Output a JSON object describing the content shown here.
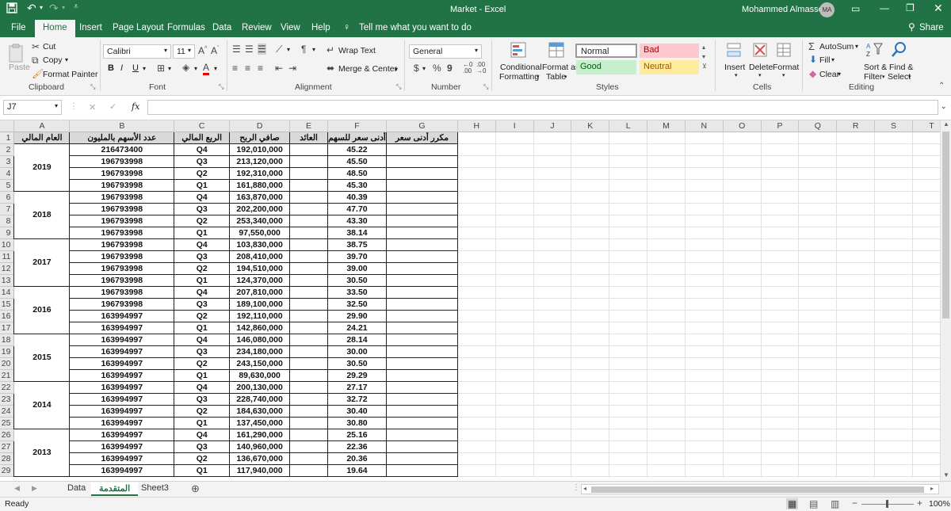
{
  "title": {
    "text": "Market  -  Excel",
    "user": "Mohammed Almasseri",
    "avatar": "MA"
  },
  "tabs": [
    "File",
    "Home",
    "Insert",
    "Page Layout",
    "Formulas",
    "Data",
    "Review",
    "View",
    "Help"
  ],
  "tell_me": "Tell me what you want to do",
  "share": "Share",
  "clipboard": {
    "paste": "Paste",
    "cut": "Cut",
    "copy": "Copy",
    "format_painter": "Format Painter",
    "group": "Clipboard"
  },
  "font": {
    "name": "Calibri",
    "size": "11",
    "bold": "B",
    "italic": "I",
    "underline": "U",
    "group": "Font"
  },
  "alignment": {
    "wrap": "Wrap Text",
    "merge": "Merge & Center",
    "group": "Alignment"
  },
  "number": {
    "format": "General",
    "currency": "$",
    "percent": "%",
    "comma": "9",
    "group": "Number"
  },
  "styles": {
    "cond1": "Conditional",
    "cond2": "Formatting",
    "fmt1": "Format as",
    "fmt2": "Table",
    "normal": "Normal",
    "bad": "Bad",
    "good": "Good",
    "neutral": "Neutral",
    "group": "Styles"
  },
  "cells": {
    "insert": "Insert",
    "delete": "Delete",
    "format": "Format",
    "group": "Cells"
  },
  "editing": {
    "autosum": "AutoSum",
    "fill": "Fill",
    "clear": "Clear",
    "sort1": "Sort &",
    "sort2": "Filter",
    "find1": "Find &",
    "find2": "Select",
    "group": "Editing"
  },
  "formula_bar": {
    "name_box": "J7",
    "value": "",
    "fx": "fx"
  },
  "columns": [
    "A",
    "B",
    "C",
    "D",
    "E",
    "F",
    "G",
    "H",
    "I",
    "J",
    "K",
    "L",
    "M",
    "N",
    "O",
    "P",
    "Q",
    "R",
    "S",
    "T"
  ],
  "header_row": [
    "العام المالي",
    "عدد الأسهم بالمليون",
    "الربع المالي",
    "صافي الربح",
    "العائد",
    "أدنى سعر للسهم",
    "مكرر أدنى سعر"
  ],
  "year_groups": [
    {
      "year": "2019",
      "rows": [
        [
          "216473400",
          "Q4",
          "192,010,000",
          "45.22"
        ],
        [
          "196793998",
          "Q3",
          "213,120,000",
          "45.50"
        ],
        [
          "196793998",
          "Q2",
          "192,310,000",
          "48.50"
        ],
        [
          "196793998",
          "Q1",
          "161,880,000",
          "45.30"
        ]
      ]
    },
    {
      "year": "2018",
      "rows": [
        [
          "196793998",
          "Q4",
          "163,870,000",
          "40.39"
        ],
        [
          "196793998",
          "Q3",
          "202,200,000",
          "47.70"
        ],
        [
          "196793998",
          "Q2",
          "253,340,000",
          "43.30"
        ],
        [
          "196793998",
          "Q1",
          "97,550,000",
          "38.14"
        ]
      ]
    },
    {
      "year": "2017",
      "rows": [
        [
          "196793998",
          "Q4",
          "103,830,000",
          "38.75"
        ],
        [
          "196793998",
          "Q3",
          "208,410,000",
          "39.70"
        ],
        [
          "196793998",
          "Q2",
          "194,510,000",
          "39.00"
        ],
        [
          "196793998",
          "Q1",
          "124,370,000",
          "30.50"
        ]
      ]
    },
    {
      "year": "2016",
      "rows": [
        [
          "196793998",
          "Q4",
          "207,810,000",
          "33.50"
        ],
        [
          "196793998",
          "Q3",
          "189,100,000",
          "32.50"
        ],
        [
          "163994997",
          "Q2",
          "192,110,000",
          "29.90"
        ],
        [
          "163994997",
          "Q1",
          "142,860,000",
          "24.21"
        ]
      ]
    },
    {
      "year": "2015",
      "rows": [
        [
          "163994997",
          "Q4",
          "146,080,000",
          "28.14"
        ],
        [
          "163994997",
          "Q3",
          "234,180,000",
          "30.00"
        ],
        [
          "163994997",
          "Q2",
          "243,150,000",
          "30.50"
        ],
        [
          "163994997",
          "Q1",
          "89,630,000",
          "29.29"
        ]
      ]
    },
    {
      "year": "2014",
      "rows": [
        [
          "163994997",
          "Q4",
          "200,130,000",
          "27.17"
        ],
        [
          "163994997",
          "Q3",
          "228,740,000",
          "32.72"
        ],
        [
          "163994997",
          "Q2",
          "184,630,000",
          "30.40"
        ],
        [
          "163994997",
          "Q1",
          "137,450,000",
          "30.80"
        ]
      ]
    },
    {
      "year": "2013",
      "rows": [
        [
          "163994997",
          "Q4",
          "161,290,000",
          "25.16"
        ],
        [
          "163994997",
          "Q3",
          "140,960,000",
          "22.36"
        ],
        [
          "163994997",
          "Q2",
          "136,670,000",
          "20.36"
        ],
        [
          "163994997",
          "Q1",
          "117,940,000",
          "19.64"
        ]
      ]
    }
  ],
  "row_numbers": [
    "1",
    "2",
    "3",
    "4",
    "5",
    "6",
    "7",
    "8",
    "9",
    "10",
    "11",
    "12",
    "13",
    "14",
    "15",
    "16",
    "17",
    "18",
    "19",
    "20",
    "21",
    "22",
    "23",
    "24",
    "25",
    "26",
    "27",
    "28",
    "29"
  ],
  "sheets": [
    "Data",
    "المتقدمة",
    "Sheet3"
  ],
  "active_sheet": 1,
  "status": {
    "ready": "Ready",
    "zoom": "100%"
  },
  "colors": {
    "excel_green": "#217346",
    "bad_bg": "#ffc7ce",
    "good_bg": "#c6efce",
    "neutral_bg": "#ffeb9c"
  }
}
